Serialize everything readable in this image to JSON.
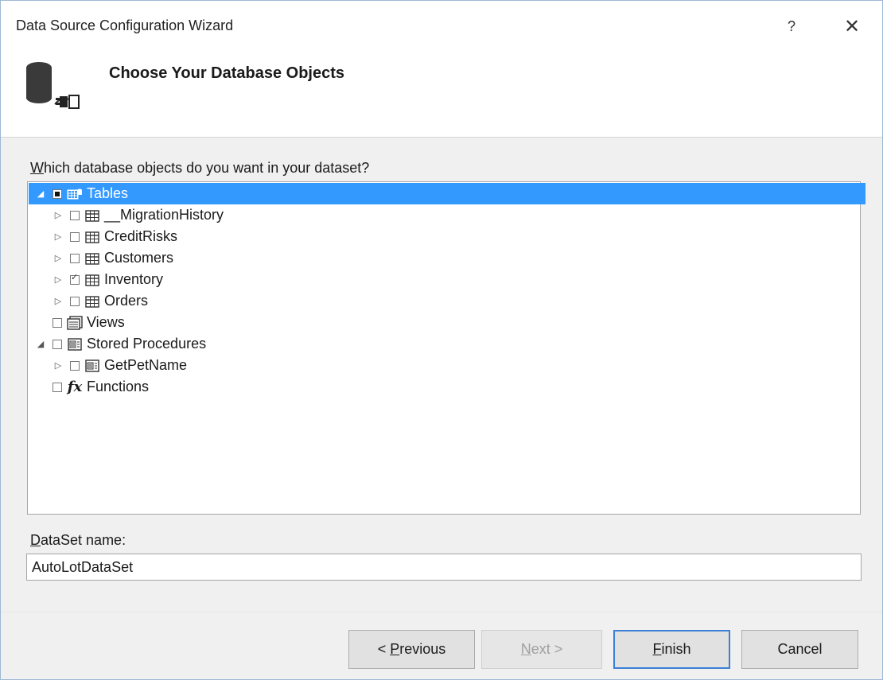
{
  "window": {
    "title": "Data Source Configuration Wizard",
    "help": "?",
    "close": "✕"
  },
  "header": {
    "heading": "Choose Your Database Objects"
  },
  "prompt": {
    "text": "Which database objects do you want in your dataset?",
    "access_key": "W",
    "rest": "hich database objects do you want in your dataset?"
  },
  "tree": {
    "items": [
      {
        "label": "Tables",
        "expander": "◢",
        "check": "partial",
        "icon": "tables-icon",
        "level": 0,
        "selected": true
      },
      {
        "label": "__MigrationHistory",
        "expander": "▷",
        "check": "unchecked",
        "icon": "table-icon",
        "level": 1
      },
      {
        "label": "CreditRisks",
        "expander": "▷",
        "check": "unchecked",
        "icon": "table-icon",
        "level": 1
      },
      {
        "label": "Customers",
        "expander": "▷",
        "check": "unchecked",
        "icon": "table-icon",
        "level": 1
      },
      {
        "label": "Inventory",
        "expander": "▷",
        "check": "checked",
        "icon": "table-icon",
        "level": 1
      },
      {
        "label": "Orders",
        "expander": "▷",
        "check": "unchecked",
        "icon": "table-icon",
        "level": 1
      },
      {
        "label": "Views",
        "expander": "",
        "check": "unchecked",
        "icon": "views-icon",
        "level": 0
      },
      {
        "label": "Stored Procedures",
        "expander": "◢",
        "check": "unchecked",
        "icon": "stored-procedure-icon",
        "level": 0
      },
      {
        "label": "GetPetName",
        "expander": "▷",
        "check": "unchecked",
        "icon": "stored-procedure-icon",
        "level": 1
      },
      {
        "label": "Functions",
        "expander": "",
        "check": "unchecked",
        "icon": "function-icon",
        "level": 0
      }
    ]
  },
  "dataset": {
    "label_key": "D",
    "label_rest": "ataSet name:",
    "value": "AutoLotDataSet"
  },
  "buttons": {
    "previous": {
      "prefix": "< ",
      "key": "P",
      "rest": "revious",
      "enabled": true
    },
    "next": {
      "key": "N",
      "rest": "ext >",
      "enabled": false
    },
    "finish": {
      "key": "F",
      "rest": "inish",
      "enabled": true
    },
    "cancel": {
      "label": "Cancel",
      "enabled": true
    }
  }
}
